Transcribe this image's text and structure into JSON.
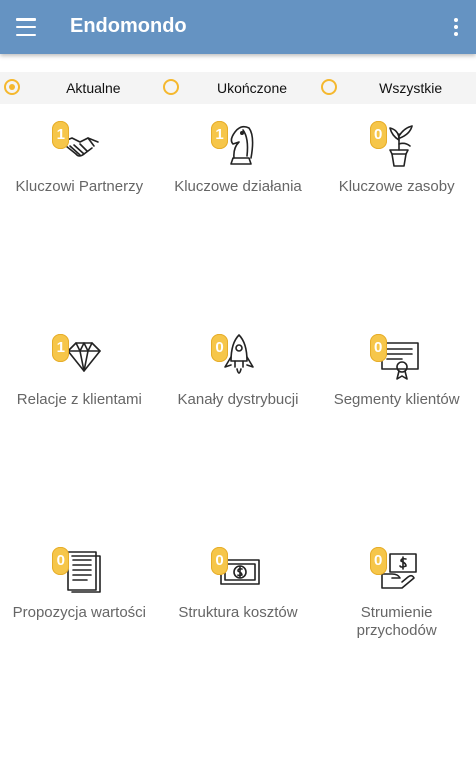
{
  "app": {
    "title": "Endomondo"
  },
  "filters": [
    {
      "label": "Aktualne",
      "checked": true
    },
    {
      "label": "Ukończone",
      "checked": false
    },
    {
      "label": "Wszystkie",
      "checked": false
    }
  ],
  "tiles": [
    {
      "label": "Kluczowi Partnerzy",
      "count": "1",
      "icon": "handshake-icon"
    },
    {
      "label": "Kluczowe działania",
      "count": "1",
      "icon": "chess-knight-icon"
    },
    {
      "label": "Kluczowe zasoby",
      "count": "0",
      "icon": "plant-pot-icon"
    },
    {
      "label": "Relacje z klientami",
      "count": "1",
      "icon": "diamond-icon"
    },
    {
      "label": "Kanały dystrybucji",
      "count": "0",
      "icon": "rocket-icon"
    },
    {
      "label": "Segmenty klientów",
      "count": "0",
      "icon": "certificate-icon"
    },
    {
      "label": "Propozycja wartości",
      "count": "0",
      "icon": "document-icon"
    },
    {
      "label": "Struktura kosztów",
      "count": "0",
      "icon": "dollar-bill-icon"
    },
    {
      "label": "Strumienie przychodów",
      "count": "0",
      "icon": "money-hand-icon"
    }
  ],
  "colors": {
    "appbar": "#6593c2",
    "accent": "#f5b82e",
    "badge": "#f6c64a"
  }
}
